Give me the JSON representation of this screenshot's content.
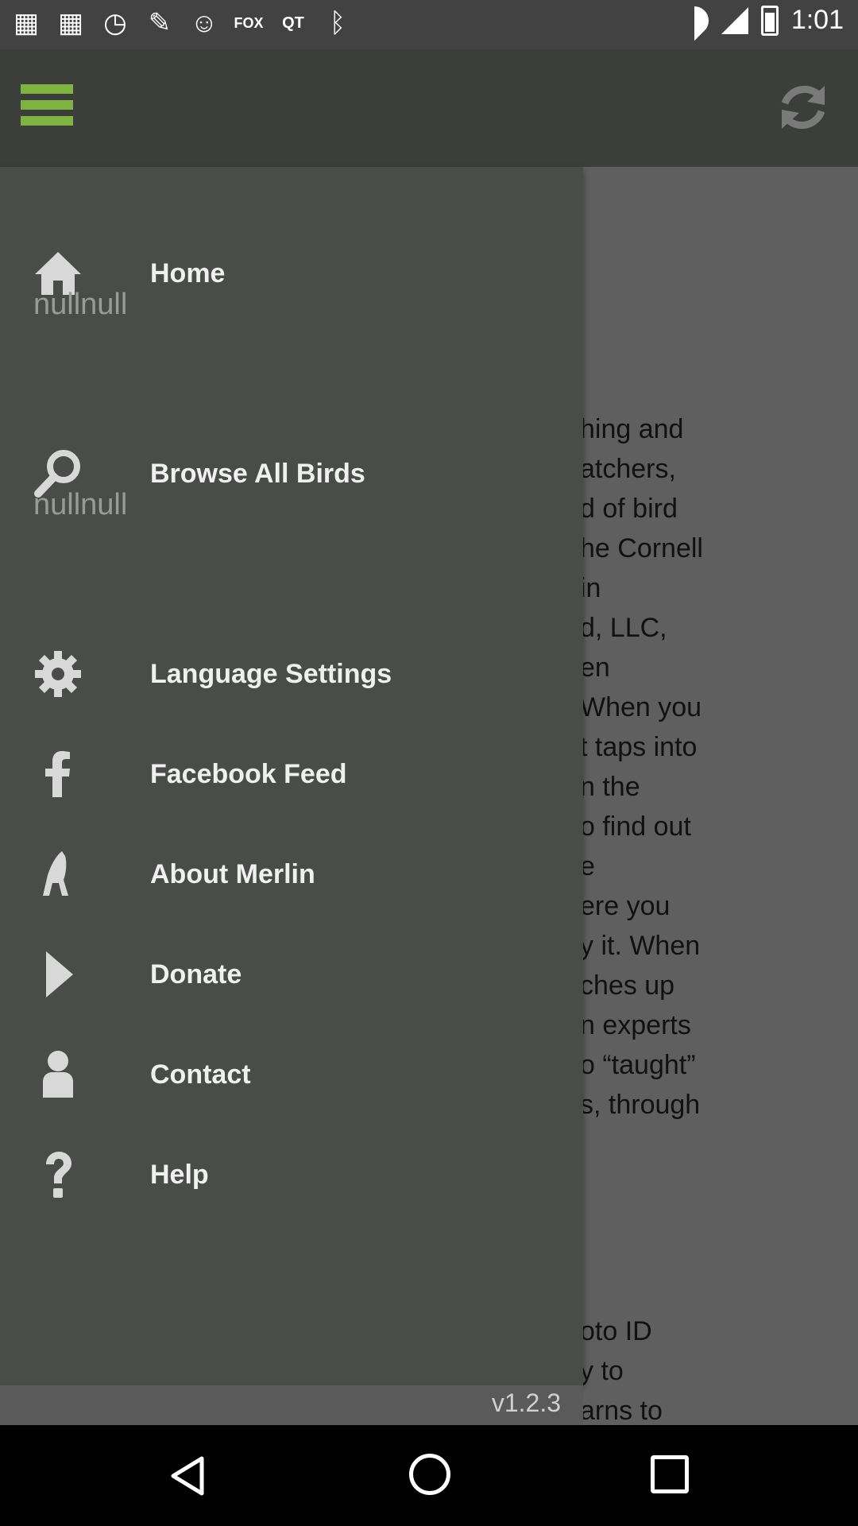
{
  "status_bar": {
    "time": "1:01",
    "notification_icons": [
      "grid-icon",
      "grid-icon",
      "timer-icon",
      "wrench-icon",
      "smiley-icon",
      "fox-sports-icon",
      "qt-icon",
      "bluetooth-icon"
    ]
  },
  "app_bar": {
    "menu_icon": "hamburger-icon",
    "refresh_icon": "refresh-icon",
    "accent_color": "#7db33e"
  },
  "background_content": {
    "lines": [
      "hing and",
      "atchers,",
      "d of bird",
      "he Cornell",
      "in",
      "d, LLC,",
      "en",
      "When you",
      "t taps into",
      "n the",
      "o find out",
      "e",
      "ere you",
      "y it. When",
      "ches up",
      "n experts",
      "o “taught”",
      "s, through"
    ],
    "bottom_lines": [
      "oto ID",
      "y to",
      "arns to"
    ]
  },
  "drawer": {
    "items": [
      {
        "label": "Home",
        "icon": "home-icon",
        "sub": "nullnull"
      },
      {
        "label": "Browse All Birds",
        "icon": "search-icon",
        "sub": "nullnull"
      },
      {
        "label": "Language Settings",
        "icon": "gear-icon"
      },
      {
        "label": "Facebook Feed",
        "icon": "facebook-icon"
      },
      {
        "label": "About Merlin",
        "icon": "bird-icon"
      },
      {
        "label": "Donate",
        "icon": "play-icon"
      },
      {
        "label": "Contact",
        "icon": "person-icon"
      },
      {
        "label": "Help",
        "icon": "question-icon"
      }
    ],
    "version": "v1.2.3"
  },
  "nav_bar": {
    "back": "back-icon",
    "home": "home-circle-icon",
    "recent": "recent-apps-icon"
  }
}
